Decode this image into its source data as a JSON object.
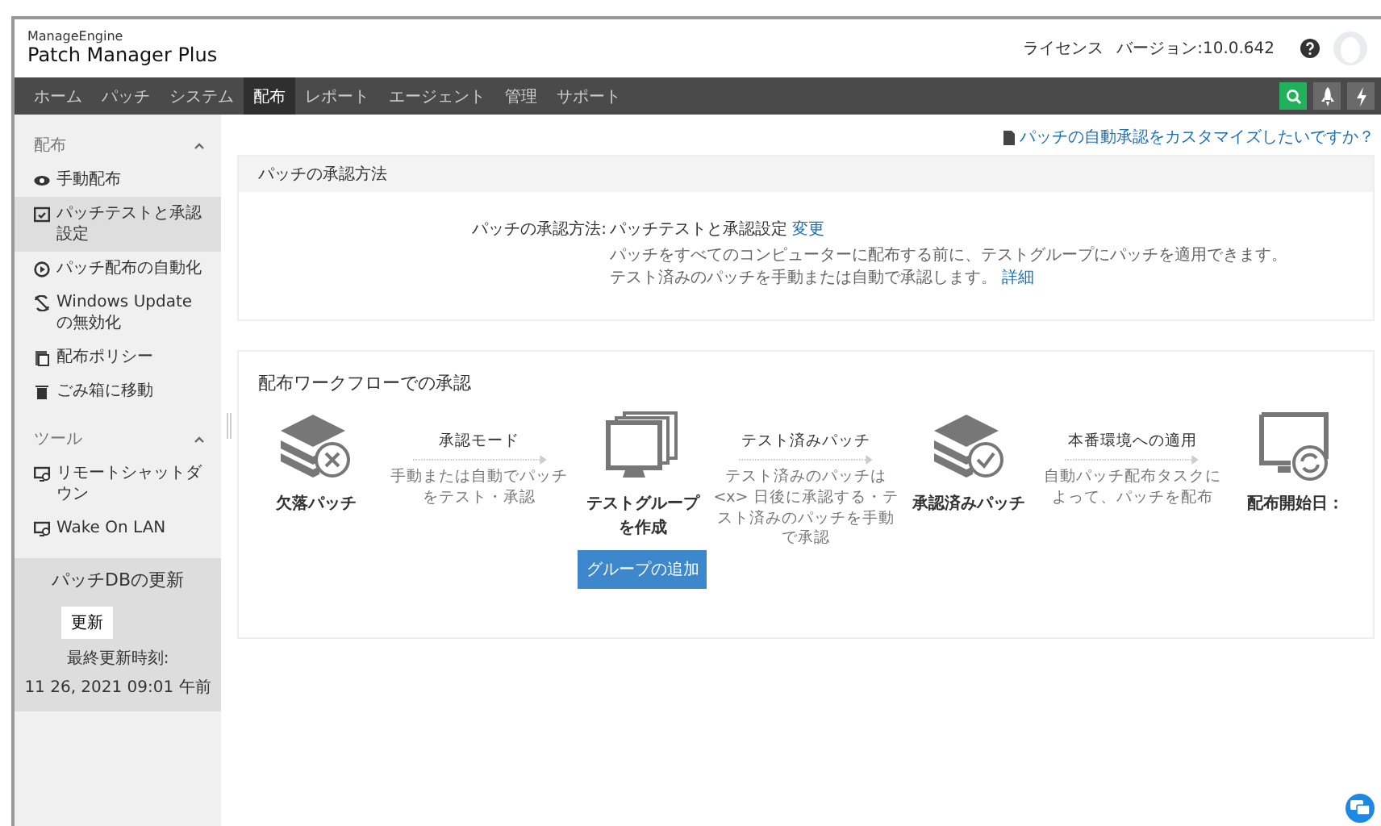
{
  "header": {
    "brand_top": "ManageEngine",
    "brand": "Patch Manager Plus",
    "license": "ライセンス",
    "version": "バージョン:10.0.642"
  },
  "nav": {
    "tabs": [
      {
        "label": "ホーム",
        "selected": false
      },
      {
        "label": "パッチ",
        "selected": false
      },
      {
        "label": "システム",
        "selected": false
      },
      {
        "label": "配布",
        "selected": true
      },
      {
        "label": "レポート",
        "selected": false
      },
      {
        "label": "エージェント",
        "selected": false
      },
      {
        "label": "管理",
        "selected": false
      },
      {
        "label": "サポート",
        "selected": false
      }
    ],
    "tools": [
      {
        "kind": "search",
        "selected": true
      },
      {
        "kind": "rocket",
        "selected": false
      },
      {
        "kind": "bolt",
        "selected": false
      }
    ]
  },
  "sidebar": {
    "sections": [
      {
        "title": "配布",
        "expanded": true,
        "items": [
          {
            "kind": "eye",
            "label": "手動配布",
            "selected": false
          },
          {
            "kind": "check",
            "label": "パッチテストと承認設定",
            "selected": true
          },
          {
            "kind": "play",
            "label": "パッチ配布の自動化",
            "selected": false
          },
          {
            "kind": "nosync",
            "label": "Windows Updateの無効化",
            "selected": false
          },
          {
            "kind": "policy",
            "label": "配布ポリシー",
            "selected": false
          },
          {
            "kind": "trash",
            "label": "ごみ箱に移動",
            "selected": false
          }
        ]
      },
      {
        "title": "ツール",
        "expanded": true,
        "items": [
          {
            "kind": "monitor",
            "label": "リモートシャットダウン",
            "selected": false
          },
          {
            "kind": "monitor",
            "label": "Wake On LAN",
            "selected": false
          }
        ]
      }
    ],
    "update": {
      "title": "パッチDBの更新",
      "button": "更新",
      "label": "最終更新時刻:",
      "time": "11 26, 2021 09:01 午前"
    }
  },
  "customize_link": "パッチの自動承認をカスタマイズしたいですか？",
  "approval_panel": {
    "title": "パッチの承認方法",
    "field_label": "パッチの承認方法:",
    "value": "パッチテストと承認設定",
    "change_link": "変更",
    "description": "パッチをすべてのコンピューターに配布する前に、テストグループにパッチを適用できます。テスト済みのパッチを手動または自動で承認します。",
    "details_link": "詳細"
  },
  "workflow_panel": {
    "title": "配布ワークフローでの承認",
    "steps": [
      {
        "kind": "missing",
        "label": "欠落パッチ"
      },
      {
        "kind": "arrow",
        "title": "承認モード",
        "text": "手動または自動でパッチをテスト・承認"
      },
      {
        "kind": "testgroup",
        "label": "テストグループを作成",
        "button": "グループの追加"
      },
      {
        "kind": "arrow",
        "title": "テスト済みパッチ",
        "text": "テスト済みのパッチは <x> 日後に承認する・テスト済みのパッチを手動で承認"
      },
      {
        "kind": "approved",
        "label": "承認済みパッチ"
      },
      {
        "kind": "arrow",
        "title": "本番環境への適用",
        "text": "自動パッチ配布タスクによって、パッチを配布"
      },
      {
        "kind": "deploy",
        "label": "配布開始日："
      }
    ]
  }
}
